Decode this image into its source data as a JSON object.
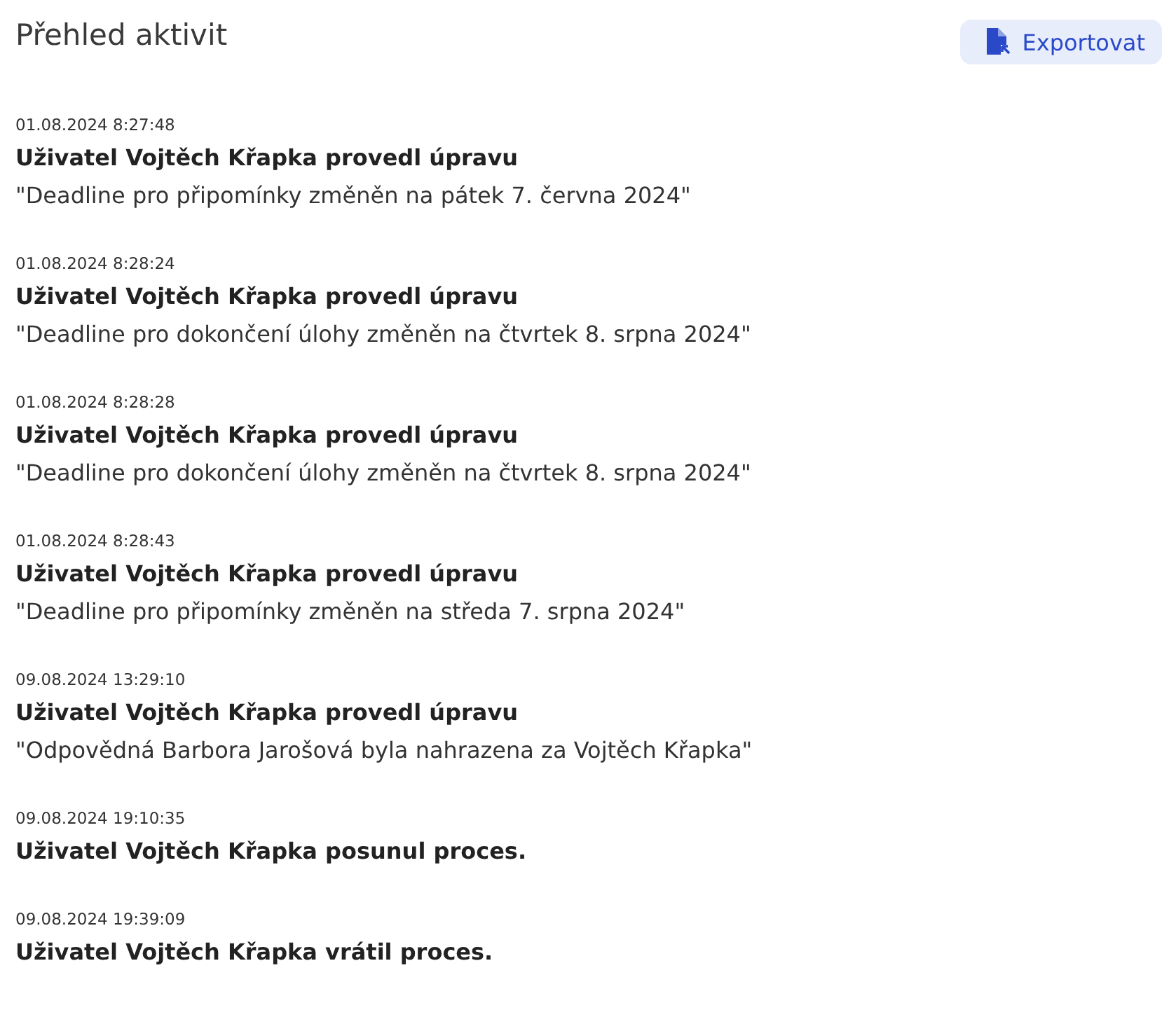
{
  "header": {
    "title": "Přehled aktivit",
    "export_button": "Exportovat"
  },
  "activities": [
    {
      "time": "01.08.2024 8:27:48",
      "action": "Uživatel Vojtěch Křapka provedl úpravu",
      "detail": "\"Deadline pro připomínky změněn na pátek 7. června 2024\""
    },
    {
      "time": "01.08.2024 8:28:24",
      "action": "Uživatel Vojtěch Křapka provedl úpravu",
      "detail": "\"Deadline pro dokončení úlohy změněn na čtvrtek 8. srpna 2024\""
    },
    {
      "time": "01.08.2024 8:28:28",
      "action": "Uživatel Vojtěch Křapka provedl úpravu",
      "detail": "\"Deadline pro dokončení úlohy změněn na čtvrtek 8. srpna 2024\""
    },
    {
      "time": "01.08.2024 8:28:43",
      "action": "Uživatel Vojtěch Křapka provedl úpravu",
      "detail": "\"Deadline pro připomínky změněn na středa 7. srpna 2024\""
    },
    {
      "time": "09.08.2024 13:29:10",
      "action": "Uživatel Vojtěch Křapka provedl úpravu",
      "detail": "\"Odpovědná Barbora Jarošová byla nahrazena za Vojtěch Křapka\""
    },
    {
      "time": "09.08.2024 19:10:35",
      "action": "Uživatel Vojtěch Křapka posunul proces."
    },
    {
      "time": "09.08.2024 19:39:09",
      "action": "Uživatel Vojtěch Křapka vrátil proces."
    }
  ]
}
